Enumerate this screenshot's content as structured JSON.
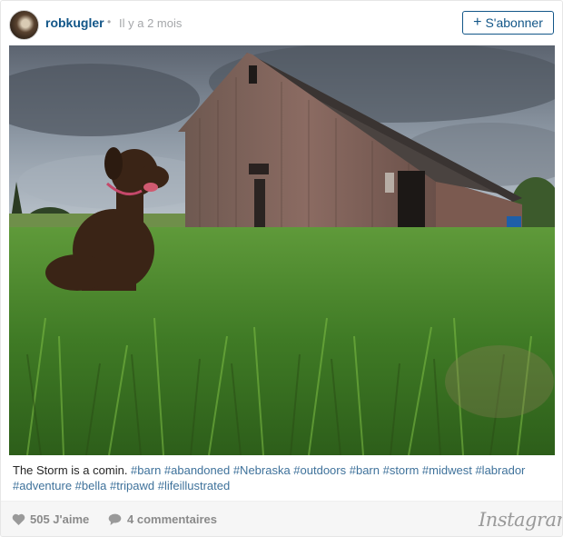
{
  "header": {
    "username": "robkugler",
    "separator": "•",
    "time_ago": "Il y a 2 mois",
    "follow_plus": "+",
    "follow_label": "S'abonner"
  },
  "photo": {
    "icon": "photo-barn-dog",
    "colors": {
      "sky": "#8a97a6",
      "barn": "#7a5f55",
      "roof": "#4a4340",
      "grass": "#4e8a2e",
      "dog": "#3a2416"
    }
  },
  "caption": {
    "text": "The Storm is a comin. ",
    "hashtags": "#barn #abandoned #Nebraska #outdoors #barn #storm #midwest #labrador #adventure #bella #tripawd #lifeillustrated"
  },
  "footer": {
    "likes": "505 J'aime",
    "comments": "4 commentaires",
    "brand": "Instagram",
    "heart_icon": "heart-icon",
    "comment_icon": "comment-bubble-icon"
  },
  "colors": {
    "link_blue": "#125688",
    "hashtag_blue": "#3f729b",
    "muted_gray": "#a5a7aa",
    "footer_bg": "#f6f6f6"
  }
}
